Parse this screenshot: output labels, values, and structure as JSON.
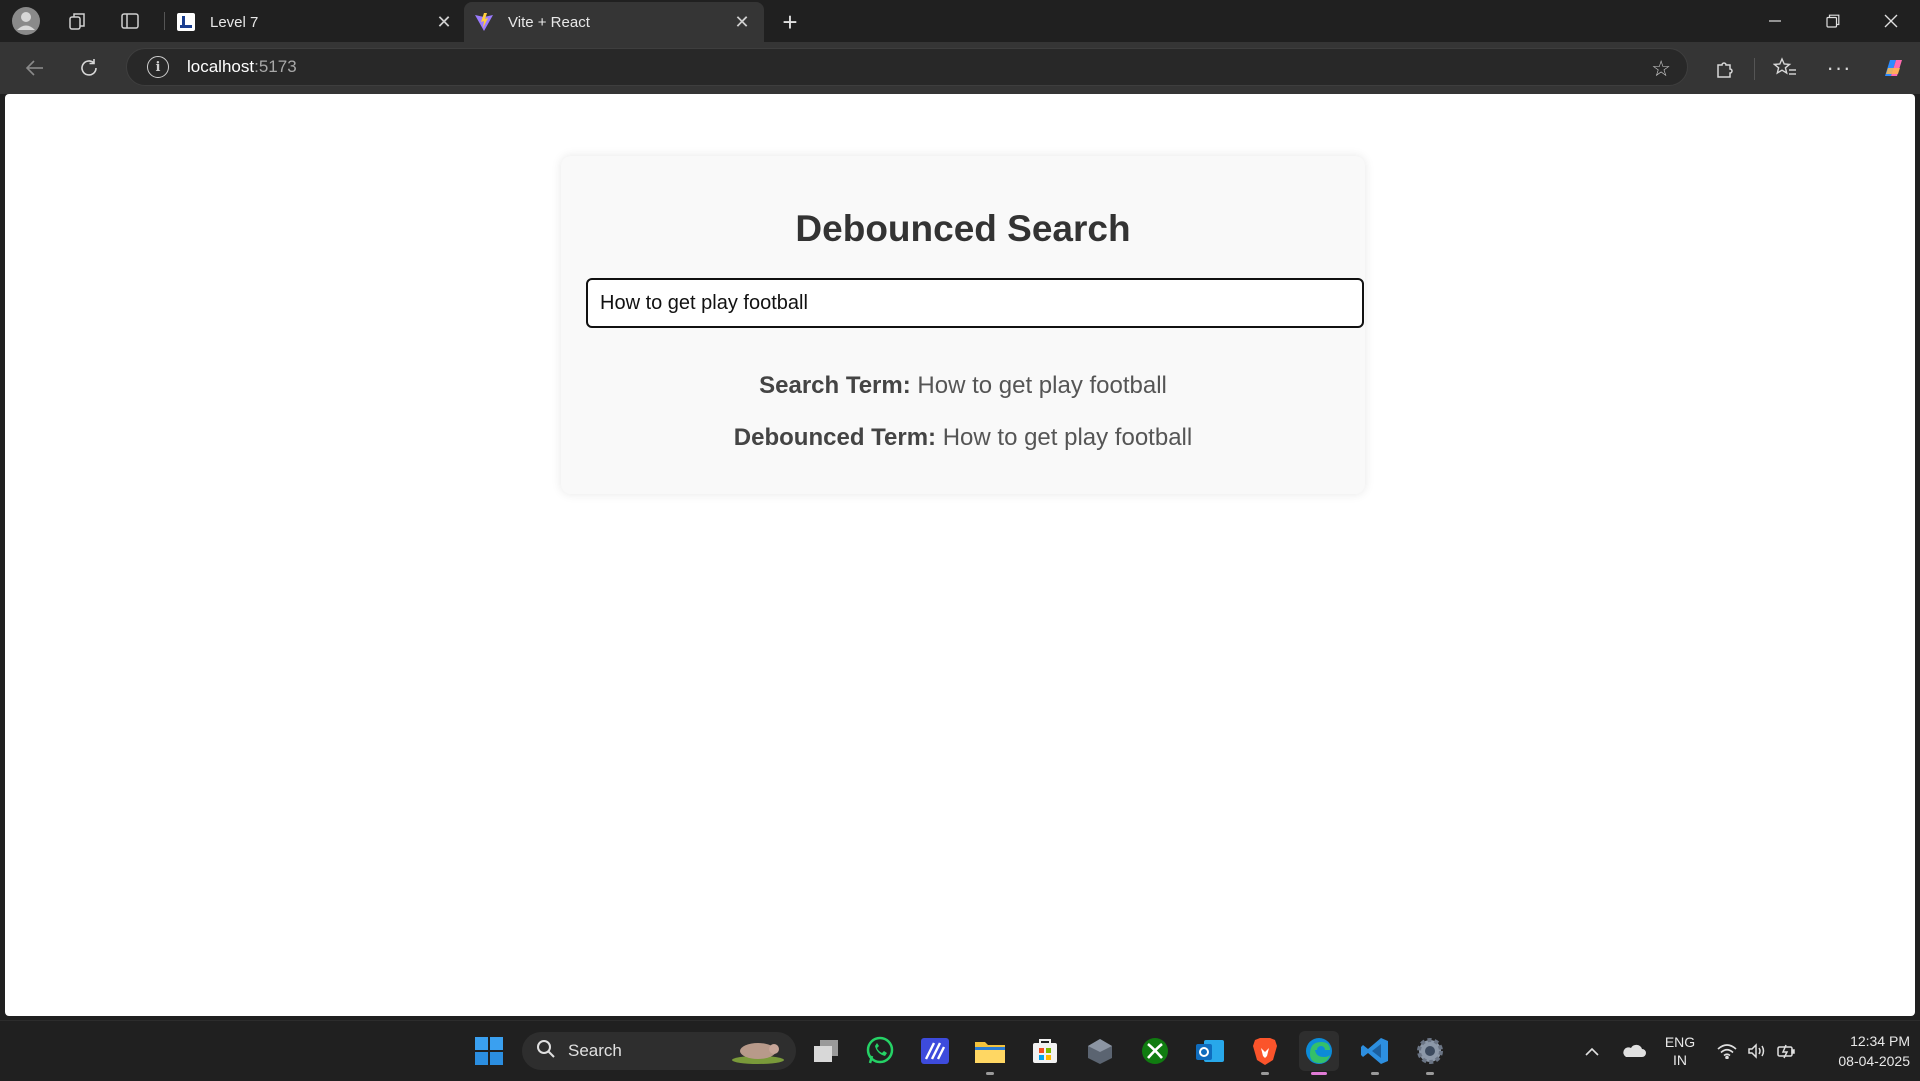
{
  "browser": {
    "tabs": [
      {
        "title": "Level 7",
        "active": false
      },
      {
        "title": "Vite + React",
        "active": true
      }
    ],
    "address": {
      "host": "localhost",
      "port": ":5173"
    }
  },
  "page": {
    "heading": "Debounced Search",
    "search_value": "How to get play football",
    "search_term_label": "Search Term:",
    "search_term_value": "How to get play football",
    "debounced_term_label": "Debounced Term:",
    "debounced_term_value": "How to get play football"
  },
  "taskbar": {
    "search_label": "Search",
    "apps": [
      "start",
      "task-view",
      "whatsapp",
      "app-purple",
      "file-explorer",
      "microsoft-store",
      "app-dark",
      "xbox",
      "outlook",
      "brave",
      "edge",
      "vscode",
      "settings"
    ],
    "tray_language": "ENG",
    "tray_region": "IN",
    "time": "12:34 PM",
    "date": "08-04-2025"
  }
}
